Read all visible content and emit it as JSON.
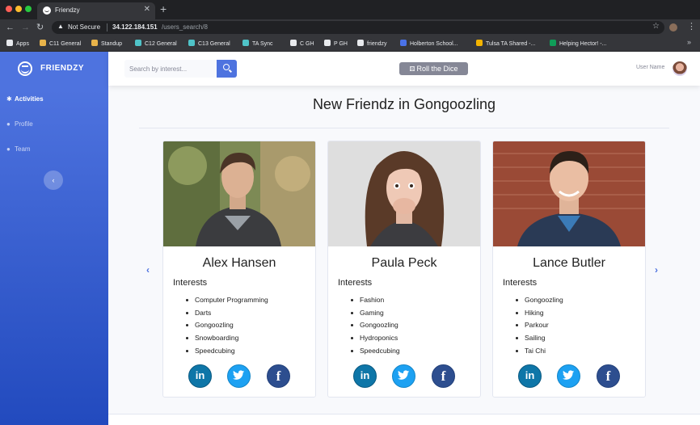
{
  "browser": {
    "tab_title": "Friendzy",
    "security_label": "Not Secure",
    "url_host": "34.122.184.151",
    "url_path": "/users_search/8",
    "bookmarks": [
      {
        "label": "Apps",
        "color": "#e8eaed"
      },
      {
        "label": "C11 General",
        "color": "#e8b34a"
      },
      {
        "label": "Standup",
        "color": "#e8b34a"
      },
      {
        "label": "C12 General",
        "color": "#4fc3c8"
      },
      {
        "label": "C13 General",
        "color": "#4fc3c8"
      },
      {
        "label": "TA Sync",
        "color": "#4fc3c8"
      },
      {
        "label": "C GH",
        "color": "#e8eaed"
      },
      {
        "label": "P GH",
        "color": "#e8eaed"
      },
      {
        "label": "friendzy",
        "color": "#e8eaed"
      },
      {
        "label": "Holberton School...",
        "color": "#4a72e8"
      },
      {
        "label": "Tulsa TA Shared -...",
        "color": "#f4b400"
      },
      {
        "label": "Helping Hector! -...",
        "color": "#0f9d58"
      }
    ]
  },
  "sidebar": {
    "brand": "FRIENDZY",
    "items": [
      {
        "label": "Activities",
        "icon": "running-icon"
      },
      {
        "label": "Profile",
        "icon": "user-icon"
      },
      {
        "label": "Team",
        "icon": "users-icon"
      }
    ]
  },
  "topbar": {
    "search_placeholder": "Search by interest...",
    "dice_label": "Roll the Dice",
    "user_name": "User Name"
  },
  "main": {
    "title": "New Friendz in Gongoozling",
    "interests_label": "Interests",
    "cards": [
      {
        "name": "Alex Hansen",
        "interests": [
          "Computer Programming",
          "Darts",
          "Gongoozling",
          "Snowboarding",
          "Speedcubing"
        ]
      },
      {
        "name": "Paula Peck",
        "interests": [
          "Fashion",
          "Gaming",
          "Gongoozling",
          "Hydroponics",
          "Speedcubing"
        ]
      },
      {
        "name": "Lance Butler",
        "interests": [
          "Gongoozling",
          "Hiking",
          "Parkour",
          "Sailing",
          "Tai Chi"
        ]
      }
    ],
    "social": {
      "linkedin": "in",
      "facebook": "f"
    }
  },
  "colors": {
    "primary": "#4e73df",
    "secondary": "#858796",
    "linkedin": "#0e76a8",
    "twitter": "#1da1f2",
    "facebook": "#2d4e8f"
  }
}
